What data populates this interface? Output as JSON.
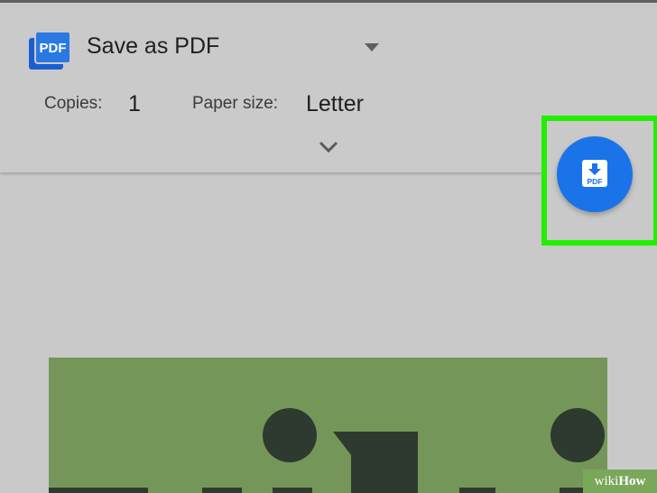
{
  "destination": {
    "name": "Save as PDF",
    "logo_text": "PDF"
  },
  "options": {
    "copies_label": "Copies:",
    "copies_value": "1",
    "paper_size_label": "Paper size:",
    "paper_size_value": "Letter"
  },
  "save_button": {
    "icon_text": "PDF",
    "icon": "pdf-download-icon",
    "color": "#1a73e8"
  },
  "highlight": {
    "color": "#22ee00"
  },
  "watermark": {
    "prefix": "wiki",
    "suffix": "How"
  }
}
